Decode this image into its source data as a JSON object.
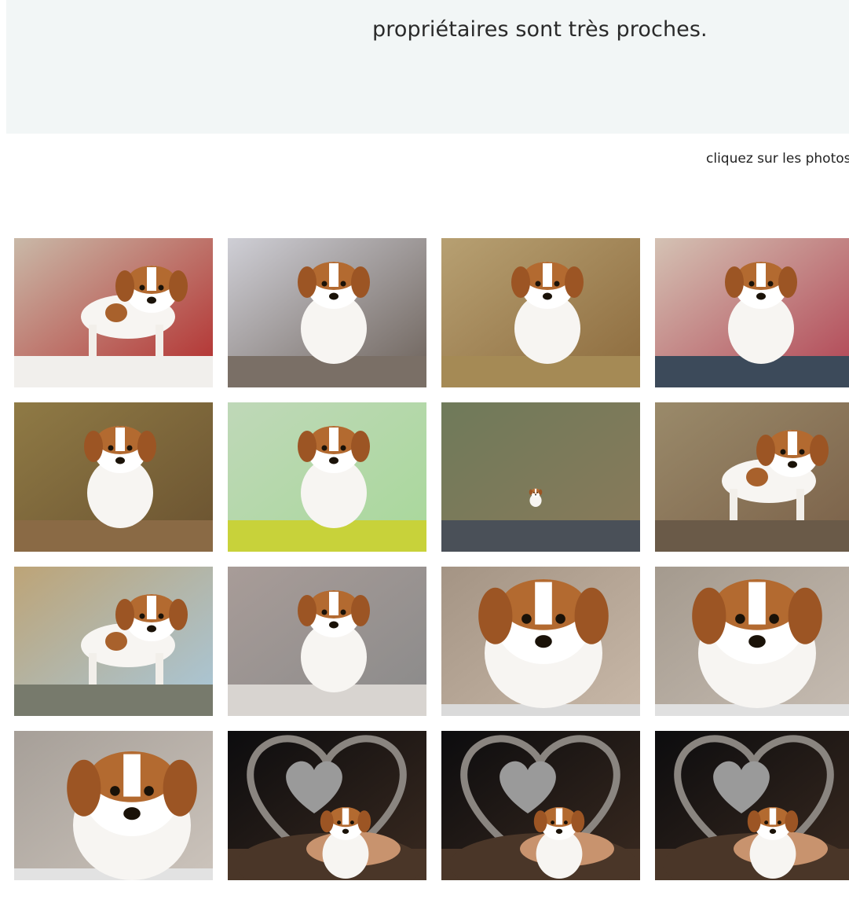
{
  "intro": {
    "text": "propriétaires sont très proches."
  },
  "hint": {
    "text": "cliquez sur les photos"
  },
  "gallery": {
    "photos": [
      {
        "bg": "#c9b9a8",
        "bg2": "#b22a2a",
        "floor": "#f1efec",
        "pose": "stand",
        "accent": "#1f2d55"
      },
      {
        "bg": "#cfcfd6",
        "bg2": "#6b6058",
        "floor": "#7a6f66",
        "pose": "front",
        "accent": "#1f2d55"
      },
      {
        "bg": "#b7a072",
        "bg2": "#8c6a3c",
        "floor": "#a58a55",
        "pose": "run",
        "accent": "#e6e1dc"
      },
      {
        "bg": "#d4c2b4",
        "bg2": "#b04050",
        "floor": "#3c4a5a",
        "pose": "front",
        "accent": "#8a5a3a"
      },
      {
        "bg": "#8f7a45",
        "bg2": "#6a5230",
        "floor": "#8a6a45",
        "pose": "climb",
        "accent": "#b06a3a"
      },
      {
        "bg": "#bfd8b8",
        "bg2": "#a8d89a",
        "floor": "#c8d23a",
        "pose": "front",
        "accent": "#9ad07a"
      },
      {
        "bg": "#6f7a5a",
        "bg2": "#8a7a5a",
        "floor": "#4a5058",
        "pose": "tiny",
        "accent": "#1a1a1a"
      },
      {
        "bg": "#9a8a6a",
        "bg2": "#7a6048",
        "floor": "#6a5a48",
        "pose": "play",
        "accent": "#e8e8e8"
      },
      {
        "bg": "#bda477",
        "bg2": "#a8c8dc",
        "floor": "#777a6c",
        "pose": "walk",
        "accent": "#e0a820"
      },
      {
        "bg": "#a89c98",
        "bg2": "#8a8a8a",
        "floor": "#d8d4d0",
        "pose": "front",
        "accent": "#c83a5a"
      },
      {
        "bg": "#a49484",
        "bg2": "#c8b8a8",
        "floor": "#dadada",
        "pose": "close",
        "accent": "#ffffff"
      },
      {
        "bg": "#a49a8e",
        "bg2": "#c6bcb2",
        "floor": "#e0e0e0",
        "pose": "close",
        "accent": "#ffffff"
      },
      {
        "bg": "#a69f98",
        "bg2": "#ccc4bc",
        "floor": "#e2e2e2",
        "pose": "profile",
        "accent": "#ffffff"
      },
      {
        "bg": "#0c0c0e",
        "bg2": "#3a2a20",
        "floor": "#4a3628",
        "pose": "heart",
        "accent": "#9a9a9a"
      },
      {
        "bg": "#0c0c0e",
        "bg2": "#3a2a20",
        "floor": "#4a3628",
        "pose": "heart2",
        "accent": "#9a9a9a"
      },
      {
        "bg": "#0c0c0e",
        "bg2": "#3a2a20",
        "floor": "#4a3628",
        "pose": "heart3",
        "accent": "#9a9a9a"
      }
    ]
  }
}
